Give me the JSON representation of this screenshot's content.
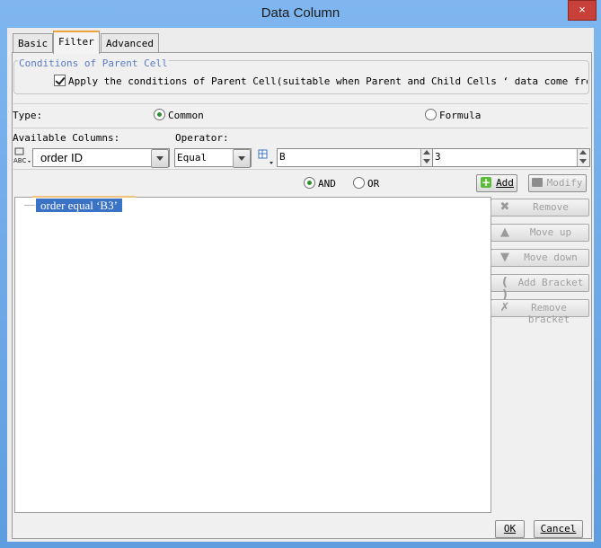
{
  "window": {
    "title": "Data Column",
    "close_label": "×"
  },
  "tabs": [
    {
      "label": "Basic",
      "active": false
    },
    {
      "label": "Filter",
      "active": true
    },
    {
      "label": "Advanced",
      "active": false
    }
  ],
  "parent_cell": {
    "group_title": "Conditions of Parent Cell",
    "checkbox_label": "Apply the conditions of Parent Cell(suitable when Parent and Child Cells ‘ data come from same da",
    "checked": true
  },
  "type": {
    "label": "Type:",
    "options": [
      "Common",
      "Formula"
    ],
    "selected": "Common"
  },
  "columns": {
    "available_label": "Available Columns:",
    "operator_label": "Operator:",
    "column_value": "order ID",
    "operator_value": "Equal",
    "value1": "B",
    "value2": "3"
  },
  "logic": {
    "options": [
      "AND",
      "OR"
    ],
    "selected": "AND"
  },
  "buttons": {
    "add": "Add",
    "modify": "Modify",
    "remove": "Remove",
    "move_up": "Move up",
    "move_down": "Move down",
    "add_bracket": "Add Bracket",
    "remove_bracket": "Remove bracket",
    "ok": "OK",
    "cancel": "Cancel"
  },
  "conditions": [
    "order equal ‘B3’"
  ],
  "colors": {
    "accent": "#3a73c6",
    "tab_highlight": "#f0a33c",
    "titlebar": "#6ea8e8"
  }
}
